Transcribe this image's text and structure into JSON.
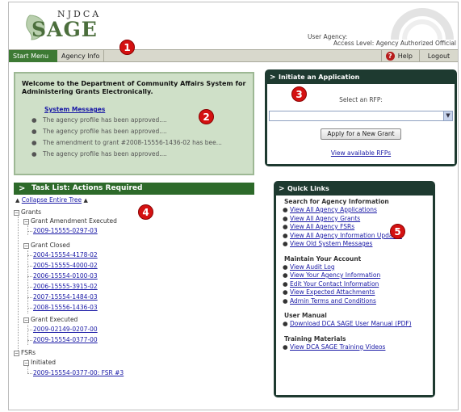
{
  "header": {
    "logo_top": "NJDCA",
    "logo_main": "SAGE",
    "user_agency_label": "User Agency:",
    "access_level_label": "Access Level: Agency Authorized Official"
  },
  "nav": {
    "start_menu": "Start Menu",
    "agency_info": "Agency Info",
    "help": "Help",
    "logout": "Logout"
  },
  "markers": [
    "1",
    "2",
    "3",
    "4",
    "5"
  ],
  "welcome": {
    "title": "Welcome to the Department of Community Affairs System for Administering Grants Electronically.",
    "system_messages_heading": "System Messages",
    "messages": [
      "The agency profile has been approved....",
      "The agency profile has been approved....",
      "The amendment to grant #2008-15556-1436-02 has bee...",
      "The agency profile has been approved...."
    ]
  },
  "initiate": {
    "title": "Initiate an Application",
    "select_label": "Select an RFP:",
    "select_value": "",
    "apply_button": "Apply for a New Grant",
    "view_rfps_link": "View available RFPs"
  },
  "task_list": {
    "title": "Task List: Actions Required",
    "collapse_link": "Collapse Entire Tree",
    "grants_label": "Grants",
    "amendment_executed_label": "Grant Amendment Executed",
    "amendment_executed_items": [
      "2009-15555-0297-03"
    ],
    "grant_closed_label": "Grant Closed",
    "grant_closed_items": [
      "2004-15554-4178-02",
      "2005-15555-4000-02",
      "2006-15554-0100-03",
      "2006-15555-3915-02",
      "2007-15554-1484-03",
      "2008-15556-1436-03"
    ],
    "grant_executed_label": "Grant Executed",
    "grant_executed_items": [
      "2009-02149-0207-00",
      "2009-15554-0377-00"
    ],
    "fsrs_label": "FSRs",
    "initiated_label": "Initiated",
    "initiated_items": [
      "2009-15554-0377-00: FSR #3"
    ]
  },
  "quick_links": {
    "title": "Quick Links",
    "sections": [
      {
        "heading": "Search for Agency Information",
        "links": [
          "View All Agency Applications",
          "View All Agency Grants",
          "View All Agency FSRs",
          "View All Agency Information Updates",
          "View Old System Messages"
        ]
      },
      {
        "heading": "Maintain Your Account",
        "links": [
          "View Audit Log",
          "View Your Agency Information",
          "Edit Your Contact Information",
          "View Expected Attachments",
          "Admin Terms and Conditions"
        ]
      },
      {
        "heading": "User Manual",
        "links": [
          "Download DCA SAGE User Manual (PDF)"
        ]
      },
      {
        "heading": "Training Materials",
        "links": [
          "View DCA SAGE Training Videos"
        ]
      }
    ]
  },
  "colors": {
    "nav_active": "#3d7a34",
    "panel_dark": "#1e3a30",
    "welcome_bg": "#cfe0c8",
    "marker_red": "#d41111",
    "link": "#1a1aa6"
  }
}
